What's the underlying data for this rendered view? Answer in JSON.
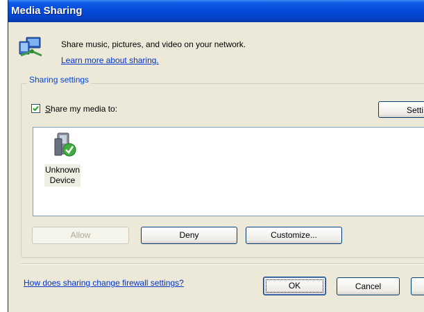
{
  "window": {
    "title": "Media Sharing"
  },
  "intro": {
    "description": "Share music, pictures, and video on your network.",
    "link": "Learn more about sharing."
  },
  "sharing_settings": {
    "legend": "Sharing settings",
    "share_checkbox": {
      "checked": true,
      "label_mnemonic": "S",
      "label_rest": "hare my media to:"
    },
    "settings_button_label": "Setti"
  },
  "devices": [
    {
      "line1": "Unknown",
      "line2": "Device",
      "status_icon": "green-check-icon"
    }
  ],
  "device_buttons": {
    "allow_label": "Allow",
    "allow_enabled": false,
    "deny_label": "Deny",
    "customize_label": "Customize..."
  },
  "footer": {
    "firewall_link": "How does sharing change firewall settings?",
    "ok_label": "OK",
    "cancel_label": "Cancel"
  },
  "colors": {
    "titlebar": "#0548d6",
    "dialog_bg": "#ece9d8",
    "link": "#0033cc",
    "legend": "#0046d5"
  }
}
